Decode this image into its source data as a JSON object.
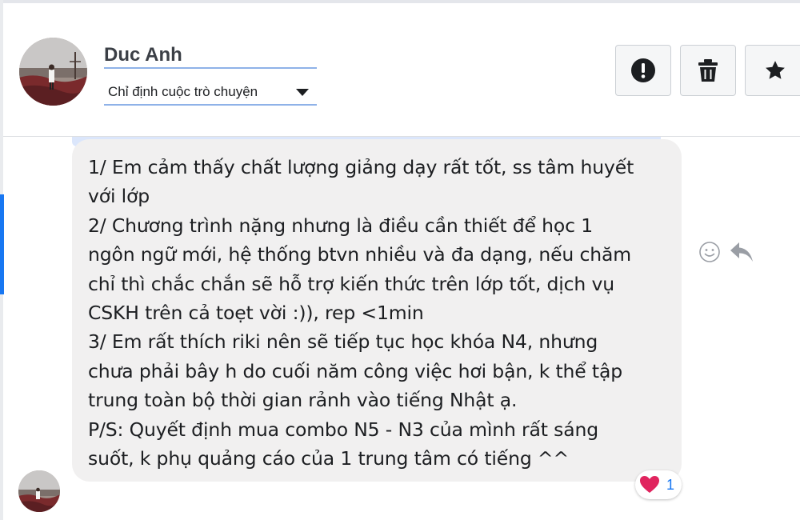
{
  "header": {
    "contact_name": "Duc Anh",
    "assign_label": "Chỉ định cuộc trò chuyện",
    "actions": [
      {
        "icon": "alert-icon"
      },
      {
        "icon": "trash-icon"
      },
      {
        "icon": "star-icon"
      }
    ]
  },
  "message": {
    "lines": [
      "1/ Em cảm thấy chất lượng giảng dạy rất tốt, ss tâm huyết",
      "với lớp",
      "2/ Chương trình nặng nhưng là điều cần thiết để học 1",
      "ngôn ngữ mới, hệ thống btvn nhiều và đa dạng, nếu chăm",
      "chỉ thì chắc chắn sẽ hỗ trợ kiến thức trên lớp tốt, dịch vụ",
      "CSKH trên cả toẹt vời :)), rep <1min",
      "3/ Em rất thích riki nên sẽ tiếp tục học khóa N4, nhưng",
      "chưa phải bây h do cuối năm công việc hơi bận, k thể tập",
      "trung toàn bộ thời gian rảnh vào tiếng Nhật ạ.",
      "P/S: Quyết định mua combo N5 - N3 của mình rất sáng",
      "suốt, k phụ quảng cáo của 1 trung tâm có tiếng ^^"
    ],
    "reaction": {
      "icon": "heart-icon",
      "count": "1"
    },
    "actions": [
      {
        "icon": "smiley-icon"
      },
      {
        "icon": "reply-icon"
      }
    ]
  },
  "colors": {
    "accent": "#1877f2",
    "bubble": "#f1f0f0",
    "heart": "#e0245e"
  }
}
